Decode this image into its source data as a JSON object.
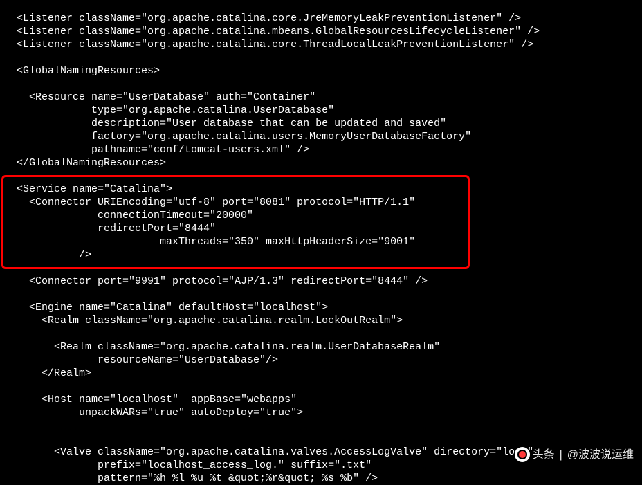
{
  "code": {
    "l1": "<Listener className=\"org.apache.catalina.core.JreMemoryLeakPreventionListener\" />",
    "l2": "<Listener className=\"org.apache.catalina.mbeans.GlobalResourcesLifecycleListener\" />",
    "l3": "<Listener className=\"org.apache.catalina.core.ThreadLocalLeakPreventionListener\" />",
    "l4": "",
    "l5": "<GlobalNamingResources>",
    "l6": "",
    "l7": "  <Resource name=\"UserDatabase\" auth=\"Container\"",
    "l8": "            type=\"org.apache.catalina.UserDatabase\"",
    "l9": "            description=\"User database that can be updated and saved\"",
    "l10": "            factory=\"org.apache.catalina.users.MemoryUserDatabaseFactory\"",
    "l11": "            pathname=\"conf/tomcat-users.xml\" />",
    "l12": "</GlobalNamingResources>",
    "l13": "",
    "l14": "<Service name=\"Catalina\">",
    "l15": "  <Connector URIEncoding=\"utf-8\" port=\"8081\" protocol=\"HTTP/1.1\"",
    "l16": "             connectionTimeout=\"20000\"",
    "l17": "             redirectPort=\"8444\"",
    "l18": "                       maxThreads=\"350\" maxHttpHeaderSize=\"9001\"",
    "l19": "          />",
    "l20": "",
    "l21": "  <Connector port=\"9991\" protocol=\"AJP/1.3\" redirectPort=\"8444\" />",
    "l22": "",
    "l23": "  <Engine name=\"Catalina\" defaultHost=\"localhost\">",
    "l24": "    <Realm className=\"org.apache.catalina.realm.LockOutRealm\">",
    "l25": "",
    "l26": "      <Realm className=\"org.apache.catalina.realm.UserDatabaseRealm\"",
    "l27": "             resourceName=\"UserDatabase\"/>",
    "l28": "    </Realm>",
    "l29": "",
    "l30": "    <Host name=\"localhost\"  appBase=\"webapps\"",
    "l31": "          unpackWARs=\"true\" autoDeploy=\"true\">",
    "l32": "",
    "l33": "",
    "l34": "      <Valve className=\"org.apache.catalina.valves.AccessLogValve\" directory=\"logs\"",
    "l35": "             prefix=\"localhost_access_log.\" suffix=\".txt\"",
    "l36": "             pattern=\"%h %l %u %t &quot;%r&quot; %s %b\" />"
  },
  "watermark": {
    "brand": "头条",
    "author": "@波波说运维"
  }
}
